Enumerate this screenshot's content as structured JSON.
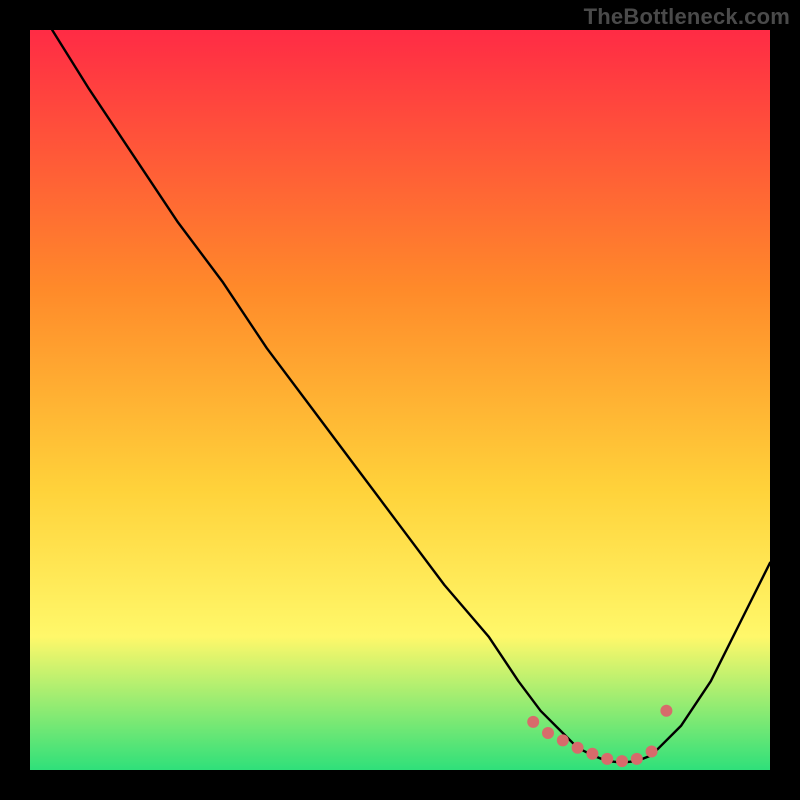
{
  "watermark": "TheBottleneck.com",
  "colors": {
    "frame": "#000000",
    "gradient_top": "#ff2b45",
    "gradient_mid1": "#ff8a2a",
    "gradient_mid2": "#ffd23a",
    "gradient_mid3": "#fff86a",
    "gradient_bottom": "#2fe07a",
    "curve": "#000000",
    "points": "#d76b6b"
  },
  "chart_data": {
    "type": "line",
    "title": "",
    "xlabel": "",
    "ylabel": "",
    "xlim": [
      0,
      100
    ],
    "ylim": [
      0,
      100
    ],
    "series": [
      {
        "name": "bottleneck-curve",
        "x": [
          3,
          8,
          14,
          20,
          26,
          32,
          38,
          44,
          50,
          56,
          62,
          66,
          69,
          72,
          74,
          76,
          78,
          80,
          82,
          84,
          88,
          92,
          96,
          100
        ],
        "y": [
          100,
          92,
          83,
          74,
          66,
          57,
          49,
          41,
          33,
          25,
          18,
          12,
          8,
          5,
          3,
          2,
          1.2,
          1,
          1.2,
          2,
          6,
          12,
          20,
          28
        ]
      }
    ],
    "points": {
      "name": "highlight-points",
      "x": [
        68,
        70,
        72,
        74,
        76,
        78,
        80,
        82,
        84,
        86
      ],
      "y": [
        6.5,
        5,
        4,
        3,
        2.2,
        1.5,
        1.2,
        1.5,
        2.5,
        8
      ]
    }
  }
}
